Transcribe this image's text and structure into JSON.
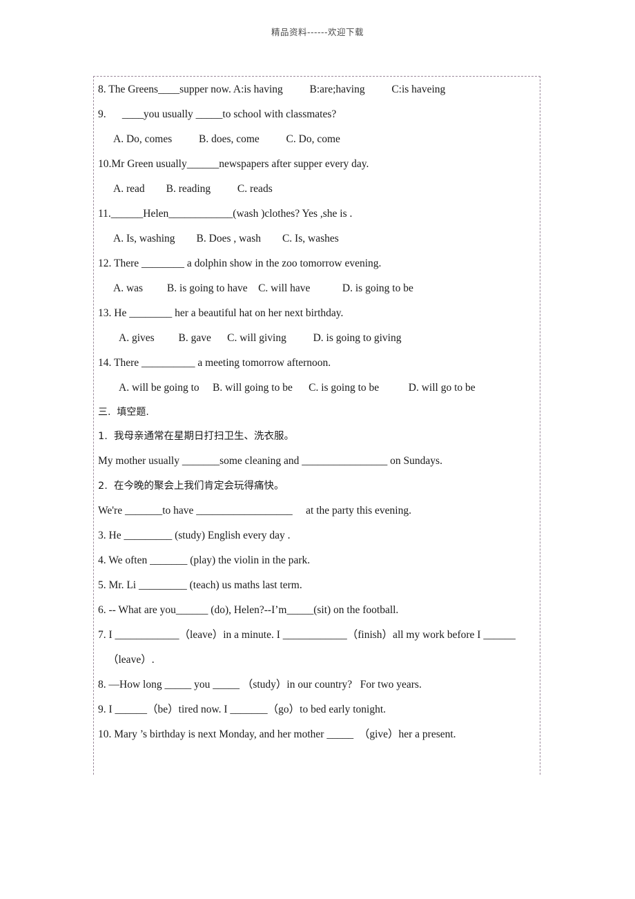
{
  "watermark": "精品资料------欢迎下载",
  "document": {
    "multiple_choice_items": [
      {
        "stem": "8. The Greens____supper now. A:is having          B:are;having          C:is haveing",
        "options": null
      },
      {
        "stem": "9.      ____you usually _____to school with classmates?",
        "options": "A. Do, comes          B. does, come          C. Do, come"
      },
      {
        "stem": "10.Mr Green usually______newspapers after supper every day.",
        "options": "A. read        B. reading          C. reads"
      },
      {
        "stem": "11.______Helen____________(wash )clothes? Yes ,she is .",
        "options": "A. Is, washing        B. Does , wash        C. Is, washes"
      },
      {
        "stem": "12. There ________ a dolphin show in the zoo tomorrow evening.",
        "options": "A. was         B. is going to have    C. will have            D. is going to be"
      },
      {
        "stem": "13. He ________ her a beautiful hat on her next birthday.",
        "options": "A. gives         B. gave      C. will giving          D. is going to giving"
      },
      {
        "stem": "14. There __________ a meeting tomorrow afternoon.",
        "options": "A. will be going to     B. will going to be      C. is going to be           D. will go to be"
      }
    ],
    "section_three": {
      "heading": "三.  填空题.",
      "items": [
        {
          "cn": "1.  我母亲通常在星期日打扫卫生、洗衣服。",
          "en": "My mother usually _______some cleaning and ________________ on Sundays."
        },
        {
          "cn": "2.  在今晚的聚会上我们肯定会玩得痛快。",
          "en": "We're _______to have __________________     at the party this evening."
        },
        {
          "cn": null,
          "en": "3. He _________ (study) English every day ."
        },
        {
          "cn": null,
          "en": "4. We often _______ (play) the violin in the park."
        },
        {
          "cn": null,
          "en": "5. Mr. Li _________ (teach) us maths last term."
        },
        {
          "cn": null,
          "en": "6. -- What are you______ (do), Helen?--I’m_____(sit) on the football."
        },
        {
          "cn": null,
          "en": "7. I ____________（leave）in a minute. I ____________（finish）all my work before I ______"
        },
        {
          "cn": null,
          "en": "（leave）."
        },
        {
          "cn": null,
          "en": "8. —How long _____ you _____ （study）in our country?   For two years."
        },
        {
          "cn": null,
          "en": "9. I ______（be）tired now. I _______（go）to bed early tonight."
        },
        {
          "cn": null,
          "en": "10. Mary ’s birthday is next Monday, and her mother _____  （give）her a present."
        }
      ]
    }
  }
}
